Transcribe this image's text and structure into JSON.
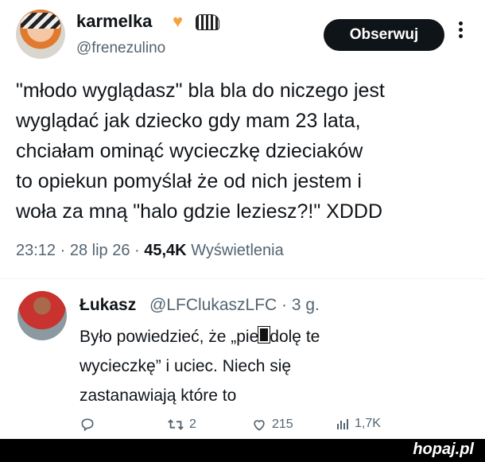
{
  "tweet": {
    "display_name": "karmelka",
    "handle": "@frenezulino",
    "follow_label": "Obserwuj",
    "text": "\"młodo wyglądasz\" bla bla do niczego jest\nwyglądać jak dziecko gdy mam 23 lata,\nchciałam ominąć wycieczkę dzieciaków\nto opiekun pomyślał że od nich jestem i\nwoła za mną \"halo gdzie leziesz?!\" XDDD",
    "time": "23:12",
    "date": "28 lip 26",
    "views_count": "45,4K",
    "views_label": "Wyświetlenia",
    "icons": [
      "heart-emoji",
      "zebra-emoji",
      "more-vertical-icon"
    ]
  },
  "reply": {
    "name": "Łukasz",
    "handle_time": "@LFClukaszLFC · 3 g.",
    "text_before": "Było powiedzieć, że „pie",
    "text_after": "dolę te\nwycieczkę” i uciec. Niech się\nzastanawiają które to",
    "replies_count": "",
    "retweets_count": "2",
    "likes_count": "215",
    "views_count": "1,7K"
  },
  "watermark": {
    "text": "hopaj.pl"
  },
  "colors": {
    "text": "#0f1419",
    "muted": "#536471",
    "follow_bg": "#0f1419"
  }
}
